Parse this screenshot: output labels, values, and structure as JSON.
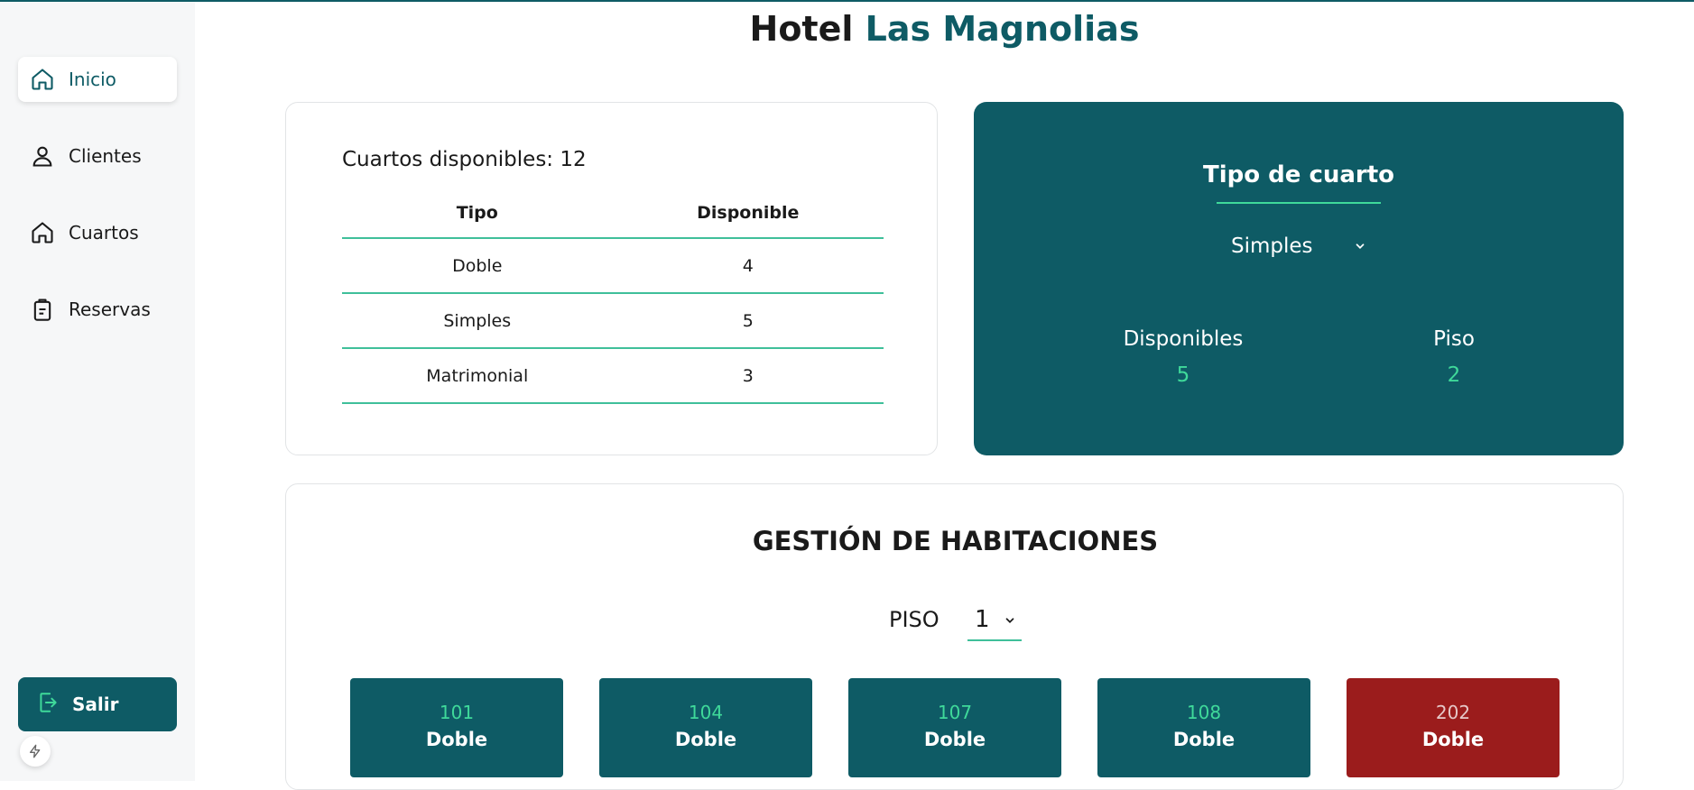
{
  "header": {
    "title_prefix": "Hotel",
    "title_brand": "Las Magnolias"
  },
  "sidebar": {
    "items": [
      {
        "label": "Inicio",
        "icon": "home-icon",
        "active": true
      },
      {
        "label": "Clientes",
        "icon": "user-icon",
        "active": false
      },
      {
        "label": "Cuartos",
        "icon": "home-icon",
        "active": false
      },
      {
        "label": "Reservas",
        "icon": "clipboard-icon",
        "active": false
      }
    ],
    "logout_label": "Salir"
  },
  "availability": {
    "title": "Cuartos disponibles: 12",
    "columns": [
      "Tipo",
      "Disponible"
    ],
    "rows": [
      {
        "tipo": "Doble",
        "disponible": "4"
      },
      {
        "tipo": "Simples",
        "disponible": "5"
      },
      {
        "tipo": "Matrimonial",
        "disponible": "3"
      }
    ]
  },
  "room_type_card": {
    "title": "Tipo de cuarto",
    "selected": "Simples",
    "disponibles_label": "Disponibles",
    "disponibles_value": "5",
    "piso_label": "Piso",
    "piso_value": "2"
  },
  "management": {
    "title": "GESTIÓN DE HABITACIONES",
    "floor_label": "PISO",
    "floor_selected": "1",
    "rooms": [
      {
        "number": "101",
        "type": "Doble",
        "status": "available"
      },
      {
        "number": "104",
        "type": "Doble",
        "status": "available"
      },
      {
        "number": "107",
        "type": "Doble",
        "status": "available"
      },
      {
        "number": "108",
        "type": "Doble",
        "status": "available"
      },
      {
        "number": "202",
        "type": "Doble",
        "status": "occupied"
      }
    ]
  },
  "colors": {
    "primary": "#0e5b65",
    "accent": "#3fd99a",
    "occupied": "#9b1c1c"
  }
}
